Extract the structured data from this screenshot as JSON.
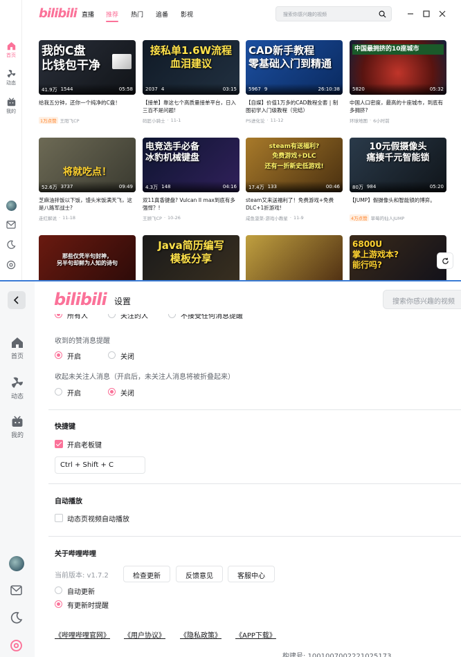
{
  "app": {
    "logo": "bilibili"
  },
  "home": {
    "sidebar": {
      "home": "首页",
      "dynamic": "动态",
      "mine": "我的"
    },
    "nav": [
      {
        "label": "直播",
        "active": false
      },
      {
        "label": "推荐",
        "active": true
      },
      {
        "label": "热门",
        "active": false
      },
      {
        "label": "追番",
        "active": false
      },
      {
        "label": "影视",
        "active": false
      }
    ],
    "search_placeholder": "搜索你感兴趣的视频",
    "videos": [
      {
        "thumb_text": "我的C盘\n比钱包干净",
        "views": "41.9万",
        "danmaku": "1544",
        "duration": "05:58",
        "title": "给我五分钟，还你一个纯净的C盘！",
        "tag": "1万点赞",
        "up": "王阳飞CP",
        "date": ""
      },
      {
        "thumb_text": "接私单1.6W流程\n血泪建议",
        "views": "2037",
        "danmaku": "4",
        "duration": "03:15",
        "title": "【接单】靠这七个高质量接单平台，日入三百不是问题!",
        "tag": "",
        "up": "码匠小骑士",
        "date": "11-1"
      },
      {
        "thumb_text": "CAD新手教程\n零基础入门到精通",
        "views": "5967",
        "danmaku": "9",
        "duration": "26:10:38",
        "title": "【自媒】价值1万多的CAD教程全套 | 制图初学入门级教程（完结）",
        "tag": "",
        "up": "PS进化论",
        "date": "11-12"
      },
      {
        "thumb_text": "中国最拥挤的10座城市",
        "views": "5820",
        "danmaku": "",
        "duration": "05:32",
        "title": "中国人口密度，最高的十座城市，到底有多拥挤?",
        "tag": "",
        "up": "环球地图",
        "date": "6小时前"
      },
      {
        "thumb_text": "将就吃点！",
        "views": "52.6万",
        "danmaku": "3737",
        "duration": "09:49",
        "title": "芝麻油拌饭以下饭，馒头米饭满天飞，这是八路军战士?",
        "tag": "",
        "up": "走红解说",
        "date": "11-18"
      },
      {
        "thumb_text": "电竞选手必备\n冰豹机械键盘",
        "views": "4.3万",
        "danmaku": "148",
        "duration": "04:16",
        "title": "双11真香键盘? Vulcan II max到底有多强悍？!",
        "tag": "",
        "up": "王顾飞CP",
        "date": "10-26"
      },
      {
        "thumb_text": "steam有送福利?\n免费游戏+DLC\n还有一折新史低游戏!",
        "views": "17.4万",
        "danmaku": "133",
        "duration": "00:46",
        "title": "steam又来送福利了！免费游戏+免费DLC+1折游戏!",
        "tag": "",
        "up": "咸鱼菠菜-游戏小教星",
        "date": "11-9"
      },
      {
        "thumb_text": "10元假摄像头\n痛揍千元智能锁",
        "views": "80万",
        "danmaku": "984",
        "duration": "05:20",
        "title": "【JUMP】假摄像头和智能锁的博弈。",
        "tag": "4万点赞",
        "up": "草莓的仙人JUMP",
        "date": ""
      },
      {
        "thumb_text": "那些仅凭半句封神，\n另半句却鲜为人知的诗句",
        "views": "",
        "danmaku": "",
        "duration": "",
        "title": "",
        "tag": "",
        "up": "",
        "date": ""
      },
      {
        "thumb_text": "Java简历编写\n模板分享",
        "views": "",
        "danmaku": "",
        "duration": "",
        "title": "",
        "tag": "",
        "up": "",
        "date": ""
      },
      {
        "thumb_text": "",
        "views": "",
        "danmaku": "",
        "duration": "",
        "title": "",
        "tag": "",
        "up": "",
        "date": ""
      },
      {
        "thumb_text": "6800U\n掌上游戏本?\n能行吗?",
        "views": "",
        "danmaku": "",
        "duration": "",
        "title": "",
        "tag": "",
        "up": "",
        "date": ""
      }
    ]
  },
  "settings": {
    "title": "设置",
    "search_placeholder": "搜索你感兴趣的视频",
    "sidebar": {
      "home": "首页",
      "dynamic": "动态",
      "mine": "我的"
    },
    "cut_row": [
      "所有人",
      "关注的人",
      "不接受任何消息提醒"
    ],
    "like_notice": {
      "label": "收到的赞消息提醒",
      "options": [
        "开启",
        "关闭"
      ],
      "selected": 0
    },
    "fold_unfollowed": {
      "label": "收起未关注人消息（开启后，未关注人消息将被折叠起来）",
      "options": [
        "开启",
        "关闭"
      ],
      "selected": 1
    },
    "shortcut": {
      "heading": "快捷键",
      "boss_key_label": "开启老板键",
      "boss_key_checked": true,
      "combo": "Ctrl + Shift + C"
    },
    "autoplay": {
      "heading": "自动播放",
      "label": "动态页视频自动播放",
      "checked": false
    },
    "about": {
      "heading": "关于哔哩哔哩",
      "version": "当前版本: v1.7.2",
      "buttons": [
        "检查更新",
        "反馈意见",
        "客服中心"
      ],
      "update_options": [
        "自动更新",
        "有更新时提醒"
      ],
      "update_selected": 1,
      "links": [
        "《哔哩哔哩官网》",
        "《用户协议》",
        "《隐私政策》",
        "《APP下载》"
      ],
      "build": "构建号: 1001007002221025173"
    }
  },
  "colors": {
    "accent": "#fb7299",
    "divider": "#e3e5e7",
    "window_border": "#3a7bd5"
  }
}
